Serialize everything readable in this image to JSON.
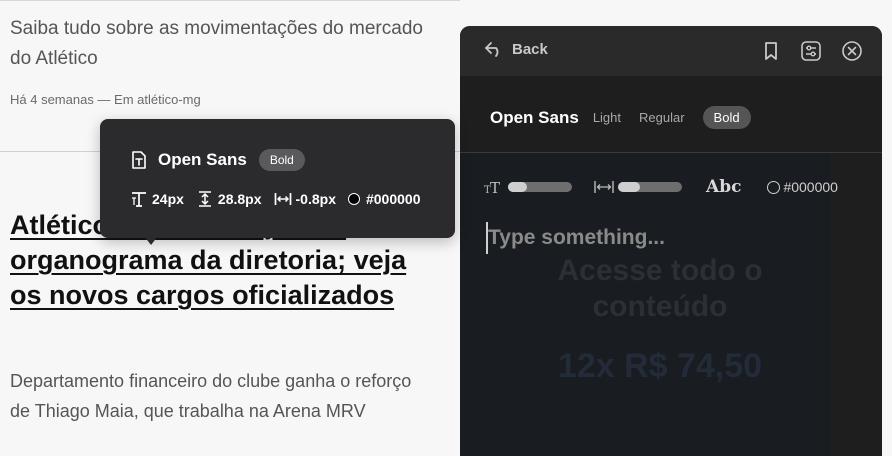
{
  "article": {
    "summary_top": "Saiba tudo sobre as movimentações do mercado do Atlético",
    "meta": "Há 4 semanas — Em atlético-mg",
    "headline": "Atlético tem mudanças no organograma da diretoria; veja os novos cargos oficializados",
    "summary_bottom": "Departamento financeiro do clube ganha o reforço de Thiago Maia, que trabalha na Arena MRV"
  },
  "tooltip": {
    "font_name": "Open Sans",
    "weight_badge": "Bold",
    "font_size": "24px",
    "line_height": "28.8px",
    "letter_spacing": "-0.8px",
    "color": "#000000"
  },
  "panel": {
    "back_label": "Back",
    "font_family": "Open Sans",
    "weights": [
      "Light",
      "Regular",
      "Bold"
    ],
    "active_weight": "Bold",
    "size_slider_fraction": 0.3,
    "spacing_slider_fraction": 0.35,
    "sample_label": "Abc",
    "color_value": "#000000",
    "input_placeholder": "Type something...",
    "ghost_text": "Acesse todo o conteúdo",
    "ghost_price": "12x R$ 74,50"
  },
  "colors": {
    "panel_bg": "#1e1e1f",
    "tooltip_bg": "#2b2b2d",
    "active_pill": "#555556"
  }
}
